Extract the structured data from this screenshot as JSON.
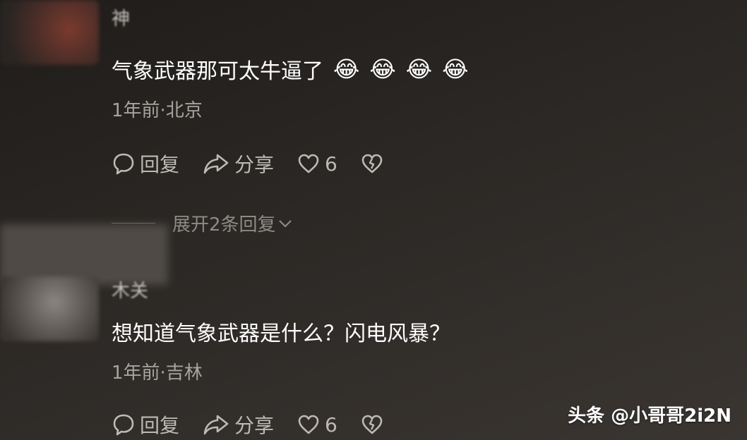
{
  "comments": [
    {
      "username": "神",
      "text": "气象武器那可太牛逼了",
      "emojis": [
        "😂",
        "😂",
        "😂",
        "😂"
      ],
      "meta": "1年前·北京",
      "reply_label": "回复",
      "share_label": "分享",
      "like_count": "6"
    },
    {
      "username": "木关",
      "text": "想知道气象武器是什么？闪电风暴？",
      "meta": "1年前·吉林",
      "reply_label": "回复",
      "share_label": "分享",
      "like_count": "6"
    }
  ],
  "expand_replies": "展开2条回复",
  "watermark": "头条 @小哥哥2i2N",
  "colors": {
    "text_primary": "#ffffff",
    "text_secondary": "#a7a39e",
    "icon": "#bdb9b4"
  }
}
